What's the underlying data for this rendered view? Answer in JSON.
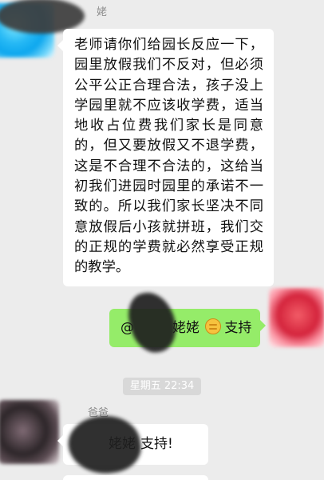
{
  "chat": {
    "messages": {
      "first_sender_visible": "姥",
      "first_text": "老师请你们给园长反应一下，园里放假我们不反对，但必须公平公正合理合法，孩子没上学园里就不应该收学费，适当地收占位费我们家长是同意的，但又要放假又不退学费，这是不合理不合法的，这给当初我们进园时园里的承诺不一致的。所以我们家长坚决不同意放假后小孩就拼班，我们交的正规的学费就必然享受正规的教学。",
      "outgoing_prefix": "@",
      "outgoing_name_fragment": "姥姥",
      "outgoing_icon": "fist-emoji-icon",
      "outgoing_text": "支持",
      "timestamp": "星期五 22:34",
      "second_sender_visible": "爸爸",
      "reply_name_fragment": "姥姥",
      "reply_text": "支持!"
    }
  }
}
